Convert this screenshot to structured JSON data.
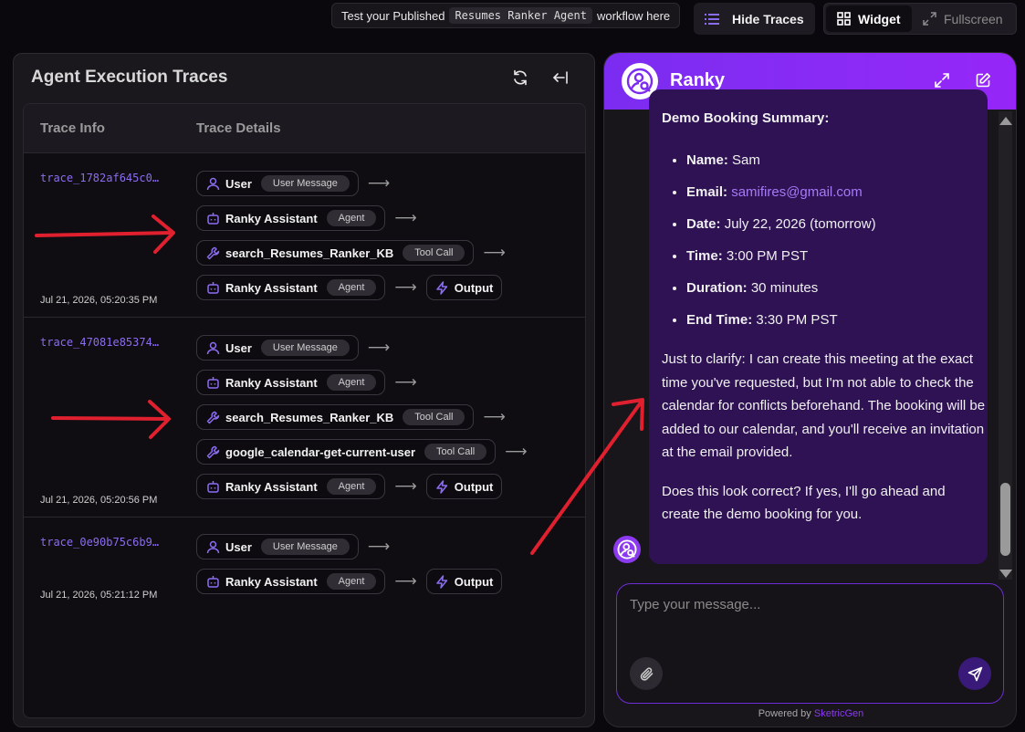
{
  "banner": {
    "prefix": "Test your Published",
    "workflow": "Resumes Ranker Agent",
    "suffix": "workflow here"
  },
  "toolbar": {
    "hide_traces": "Hide Traces",
    "widget": "Widget",
    "fullscreen": "Fullscreen"
  },
  "traces": {
    "title": "Agent Execution Traces",
    "columns": {
      "info": "Trace Info",
      "details": "Trace Details"
    },
    "rows": [
      {
        "id": "trace_1782af645c0…",
        "time": "Jul 21, 2026, 05:20:35 PM",
        "steps": [
          {
            "name": "User",
            "tag": "User Message",
            "icon": "user-icon"
          },
          {
            "name": "Ranky Assistant",
            "tag": "Agent",
            "icon": "bot-icon"
          },
          {
            "name": "search_Resumes_Ranker_KB",
            "tag": "Tool Call",
            "icon": "wrench-icon"
          },
          {
            "name": "Ranky Assistant",
            "tag": "Agent",
            "icon": "bot-icon",
            "output": "Output"
          }
        ]
      },
      {
        "id": "trace_47081e85374…",
        "time": "Jul 21, 2026, 05:20:56 PM",
        "steps": [
          {
            "name": "User",
            "tag": "User Message",
            "icon": "user-icon"
          },
          {
            "name": "Ranky Assistant",
            "tag": "Agent",
            "icon": "bot-icon"
          },
          {
            "name": "search_Resumes_Ranker_KB",
            "tag": "Tool Call",
            "icon": "wrench-icon"
          },
          {
            "name": "google_calendar-get-current-user",
            "tag": "Tool Call",
            "icon": "wrench-icon"
          },
          {
            "name": "Ranky Assistant",
            "tag": "Agent",
            "icon": "bot-icon",
            "output": "Output"
          }
        ]
      },
      {
        "id": "trace_0e90b75c6b9…",
        "time": "Jul 21, 2026, 05:21:12 PM",
        "steps": [
          {
            "name": "User",
            "tag": "User Message",
            "icon": "user-icon"
          },
          {
            "name": "Ranky Assistant",
            "tag": "Agent",
            "icon": "bot-icon",
            "output": "Output"
          }
        ]
      }
    ]
  },
  "chat": {
    "bot_name": "Ranky",
    "message": {
      "title": "Demo Booking Summary:",
      "items": [
        {
          "label": "Name:",
          "value": "Sam"
        },
        {
          "label": "Email:",
          "value": "samifires@gmail.com"
        },
        {
          "label": "Date:",
          "value": "July 22, 2026 (tomorrow)"
        },
        {
          "label": "Time:",
          "value": "3:00 PM PST"
        },
        {
          "label": "Duration:",
          "value": "30 minutes"
        },
        {
          "label": "End Time:",
          "value": "3:30 PM PST"
        }
      ],
      "para1": "Just to clarify: I can create this meeting at the exact time you've requested, but I'm not able to check the calendar for conflicts beforehand. The booking will be added to our calendar, and you'll receive an invitation at the email provided.",
      "para2": "Does this look correct? If yes, I'll go ahead and create the demo booking for you."
    },
    "input_placeholder": "Type your message...",
    "powered_prefix": "Powered by",
    "powered_brand": "SketricGen"
  },
  "colors": {
    "accent": "#8b6df0",
    "header_gradient_start": "#7b2cf0",
    "bubble": "#2e1254",
    "annotation": "#e0202f"
  }
}
